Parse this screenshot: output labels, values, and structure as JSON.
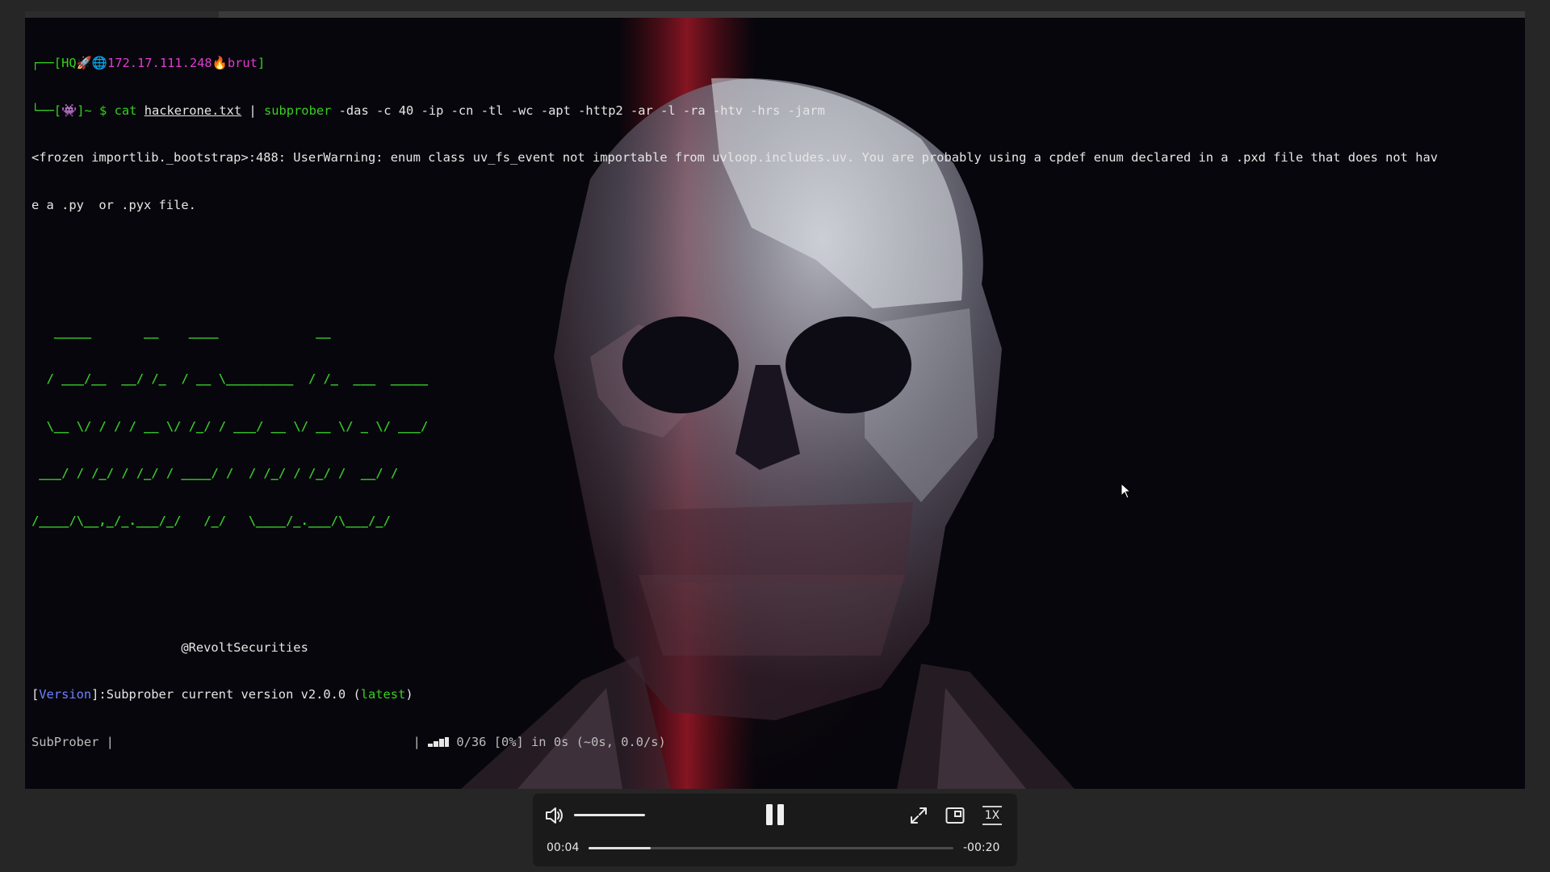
{
  "terminal": {
    "prompt_top_open": "┌──[HQ",
    "prompt_rocket": "🚀",
    "prompt_globe": "🌐",
    "prompt_ip": "172.17.111.248",
    "prompt_fire": "🔥",
    "prompt_user": "brut",
    "prompt_top_close": "]",
    "prompt_bottom_open": "└──[",
    "prompt_alien": "👾",
    "prompt_bottom_close": "]~ $ ",
    "cmd_cat": "cat",
    "cmd_file": "hackerone.txt",
    "cmd_pipe": " | ",
    "cmd_tool": "subprober",
    "cmd_args": " -das -c 40 -ip -cn -tl -wc -apt -http2 -ar -l -ra -htv -hrs -jarm",
    "warning_line1": "<frozen importlib._bootstrap>:488: UserWarning: enum class uv_fs_event not importable from uvloop.includes.uv. You are probably using a cpdef enum declared in a .pxd file that does not hav",
    "warning_line2": "e a .py  or .pyx file.",
    "ascii_banner": [
      "   _____       __    ____             __               ",
      "  / ___/__  __/ /_  / __ \\_________  / /_  ___  _____",
      "  \\__ \\/ / / / __ \\/ /_/ / ___/ __ \\/ __ \\/ _ \\/ ___/",
      " ___/ / /_/ / /_/ / ____/ /  / /_/ / /_/ /  __/ /    ",
      "/____/\\__,_/_.___/_/   /_/   \\____/_.___/\\___/_/     "
    ],
    "author": "                    @RevoltSecurities",
    "version_open": "[",
    "version_tag": "Version",
    "version_mid": "]:Subprober current version v2.0.0 (",
    "version_latest": "latest",
    "version_close": ")",
    "progress_label": "SubProber |",
    "progress_gap": "                                        | ",
    "progress_stats": " 0/36 [0%] in 0s (~0s, 0.0/s)"
  },
  "player": {
    "time_current": "00:04",
    "time_remaining": "-00:20",
    "speed_label": "1X",
    "progress_fraction": 0.17,
    "volume_fraction": 1.0
  },
  "colors": {
    "prompt_green": "#36d11d",
    "prompt_magenta": "#e13bd0",
    "version_blue": "#6f80ff",
    "player_bg": "#1a1a1a"
  },
  "icons": [
    "volume-icon",
    "pause-icon",
    "fullscreen-icon",
    "picture-in-picture-icon",
    "speed-icon",
    "mouse-cursor-icon"
  ]
}
